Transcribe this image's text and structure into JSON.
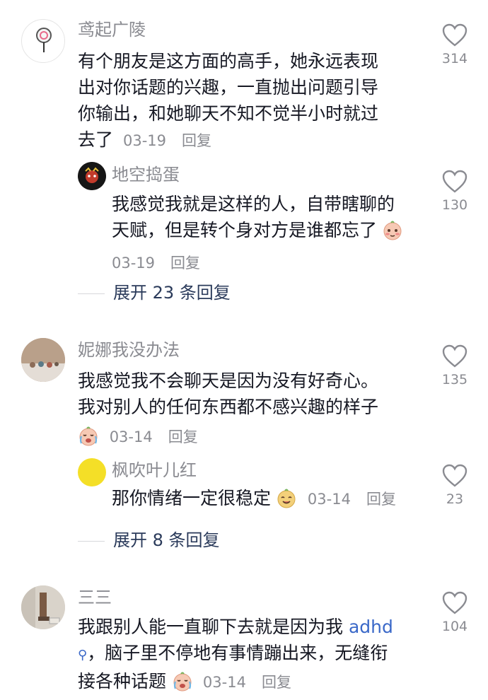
{
  "comments": [
    {
      "username": "鸢起广陵",
      "text": "有个朋友是这方面的高手，她永远表现出对你话题的兴趣，一直抛出问题引导你输出，和她聊天不知不觉半小时就过去了",
      "text_lines": [
        "有个朋友是这方面的高手，她永远表现",
        "出对你话题的兴趣，一直抛出问题引导",
        "你输出，和她聊天不知不觉半小时就过",
        "去了"
      ],
      "date": "03-19",
      "reply_label": "回复",
      "likes": "314",
      "reply": {
        "username": "地空捣蛋",
        "text_lines": [
          "我感觉我就是这样的人，自带瞎聊的",
          "天赋，但是转个身对方是谁都忘了"
        ],
        "date": "03-19",
        "reply_label": "回复",
        "likes": "130"
      },
      "expand_label": "展开 23 条回复"
    },
    {
      "username": "妮娜我没办法",
      "text_lines": [
        "我感觉我不会聊天是因为没有好奇心。",
        "我对别人的任何东西都不感兴趣的样子"
      ],
      "date": "03-14",
      "reply_label": "回复",
      "likes": "135",
      "reply": {
        "username": "枫吹叶儿红",
        "text": "那你情绪一定很稳定",
        "date": "03-14",
        "reply_label": "回复",
        "likes": "23"
      },
      "expand_label": "展开 8 条回复"
    },
    {
      "username": "三三",
      "text_line1": "我跟别人能一直聊下去就是因为我 ",
      "link": "adhd",
      "text_line2": "，脑子里不停地有事情蹦出来，无缝衔",
      "text_line3": "接各种话题",
      "date": "03-14",
      "reply_label": "回复",
      "likes": "104"
    }
  ]
}
